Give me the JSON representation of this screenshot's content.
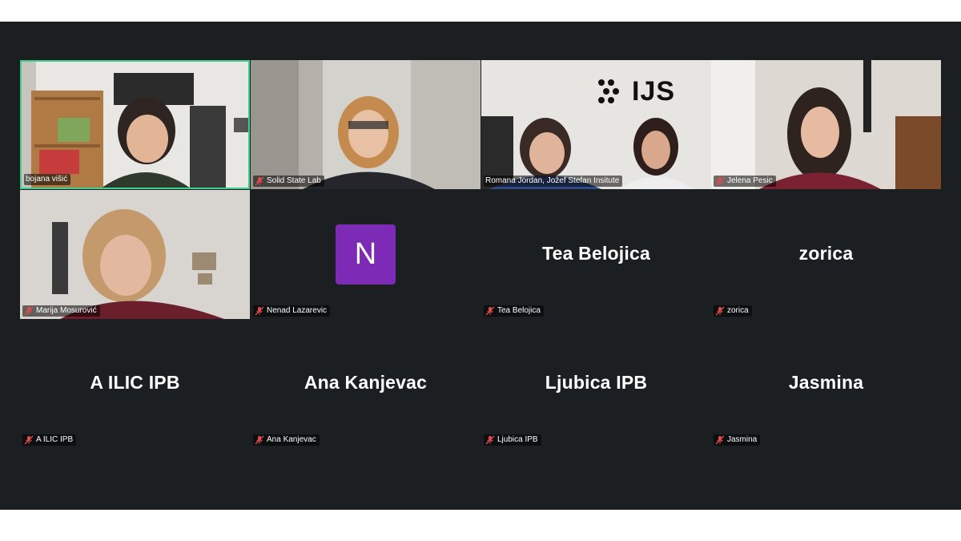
{
  "participants": [
    {
      "name": "bojana višić",
      "video": true,
      "active": true
    },
    {
      "name": "Solid State Lab",
      "video": true
    },
    {
      "name": "Romana Jordan, Jožef Stefan Insitute",
      "video": true,
      "logo_text": "IJS"
    },
    {
      "name": "Jelena Pesic",
      "video": true
    },
    {
      "name": "Marija Mosurović",
      "video": true
    },
    {
      "name": "Nenad Lazarevic",
      "video": false,
      "avatar_letter": "N"
    },
    {
      "name": "Tea Belojica",
      "video": false,
      "display": "Tea Belojica"
    },
    {
      "name": "zorica",
      "video": false,
      "display": "zorica"
    },
    {
      "name": "A ILIC IPB",
      "video": false,
      "display": "A ILIC IPB"
    },
    {
      "name": "Ana Kanjevac",
      "video": false,
      "display": "Ana Kanjevac"
    },
    {
      "name": "Ljubica IPB",
      "video": false,
      "display": "Ljubica IPB"
    },
    {
      "name": "Jasmina",
      "video": false,
      "display": "Jasmina"
    }
  ],
  "colors": {
    "background": "#1b1f22",
    "active_speaker_border": "#3fcf8e",
    "avatar": "#7d2bb6",
    "muted_icon": "#e24a4a"
  },
  "icons": {
    "muted": "microphone-off-icon"
  }
}
